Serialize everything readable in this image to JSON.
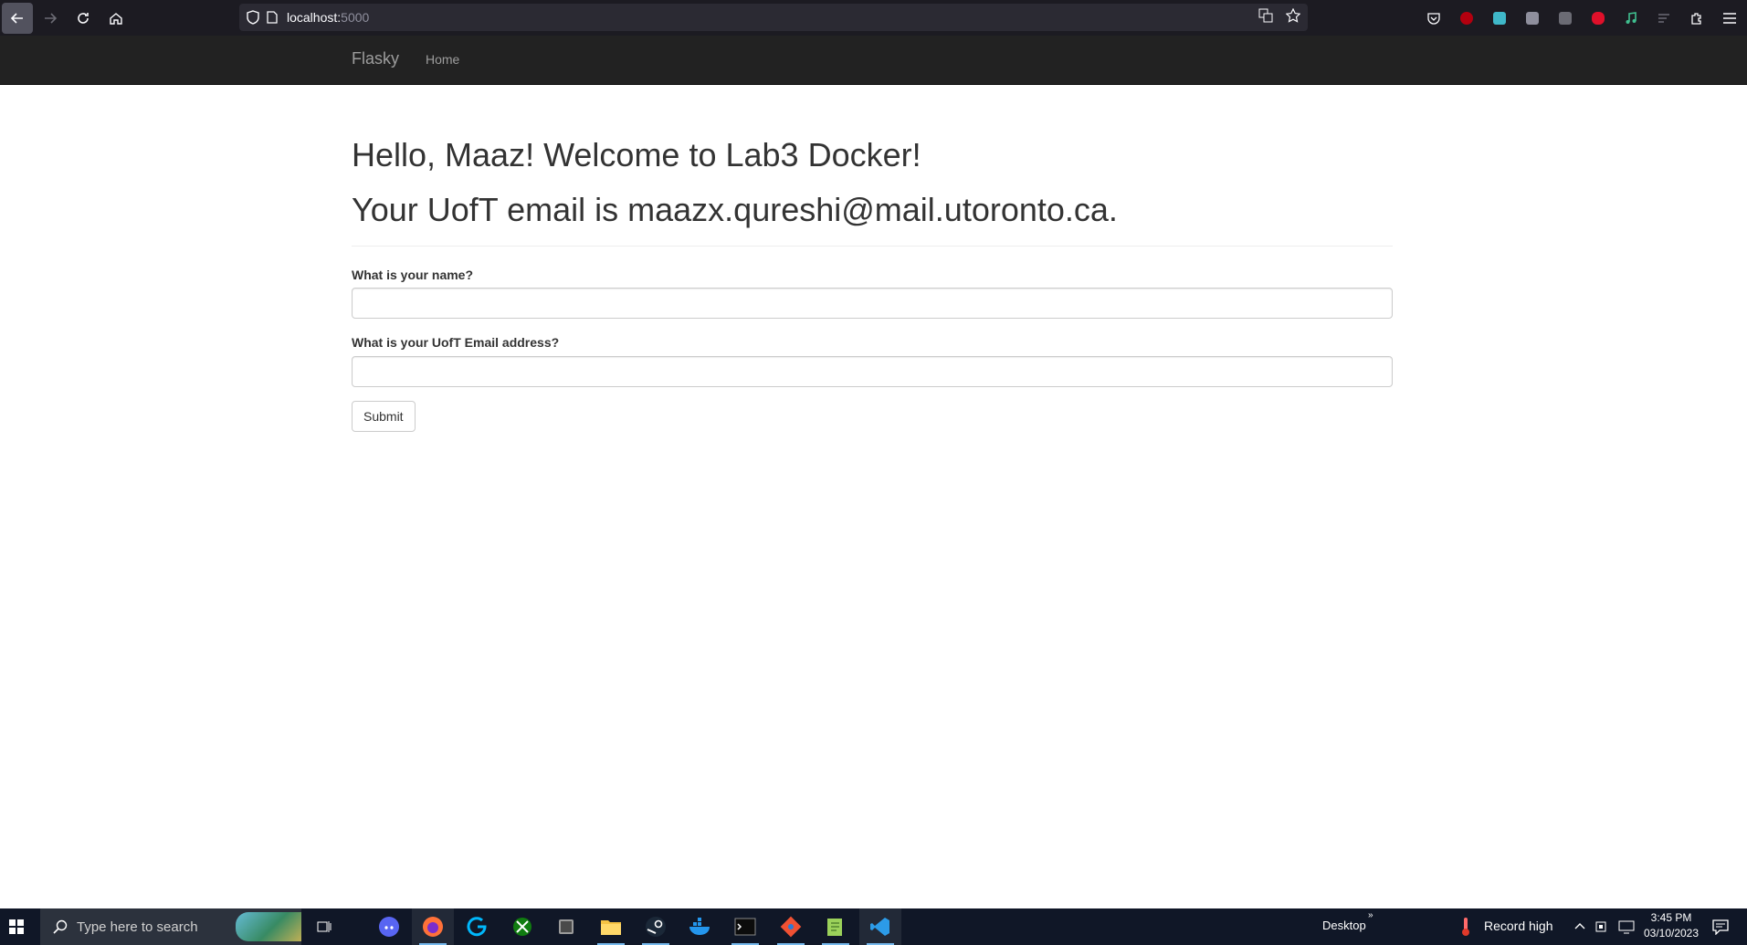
{
  "browser": {
    "url_host": "localhost:",
    "url_port": "5000"
  },
  "navbar": {
    "brand": "Flasky",
    "home": "Home"
  },
  "main": {
    "greeting": "Hello, Maaz! Welcome to Lab3 Docker!",
    "email_line": "Your UofT email is maazx.qureshi@mail.utoronto.ca.",
    "form": {
      "name_label": "What is your name?",
      "name_value": "",
      "email_label": "What is your UofT Email address?",
      "email_value": "",
      "submit_label": "Submit"
    }
  },
  "taskbar": {
    "search_placeholder": "Type here to search",
    "desktop_label": "Desktop",
    "weather_text": "Record high",
    "time": "3:45 PM",
    "date": "03/10/2023"
  },
  "colors": {
    "navbar_bg": "#222222",
    "browser_bg": "#1c1b22",
    "taskbar_bg": "#101727"
  }
}
